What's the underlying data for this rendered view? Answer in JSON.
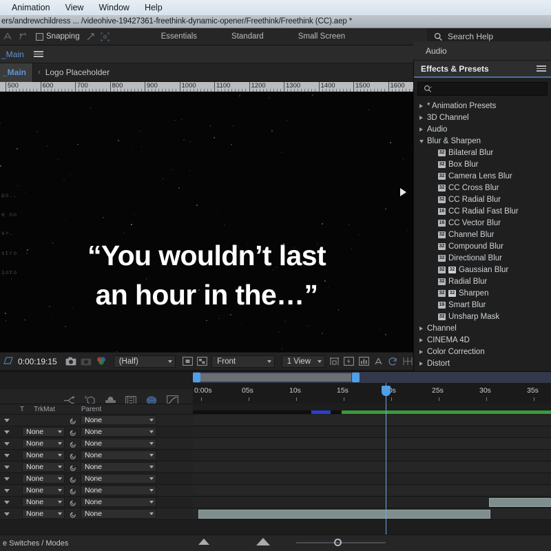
{
  "menu": {
    "items": [
      "Animation",
      "View",
      "Window",
      "Help"
    ]
  },
  "title_bar": {
    "path": "ers/andrewchildress ...  /videohive-19427361-freethink-dynamic-opener/Freethink/Freethink (CC).aep *"
  },
  "toolbar": {
    "snapping_label": "Snapping",
    "workspaces": [
      "Essentials",
      "Standard",
      "Small Screen"
    ],
    "overflow_label": "»",
    "search_placeholder": "Search Help"
  },
  "left_panel": {
    "project_tab": "_Main",
    "comp_tab_active": "_Main",
    "comp_tab_separator": "‹",
    "comp_tab_second": "Logo Placeholder"
  },
  "ruler": {
    "labels": [
      "500",
      "600",
      "700",
      "800",
      "900",
      "1000",
      "1100",
      "1200",
      "1300",
      "1400",
      "1500",
      "1600"
    ]
  },
  "viewer": {
    "quote_line1": "“You wouldn’t last",
    "quote_line2": "an hour in the…”",
    "edge_fragments": [
      "po..",
      "e no",
      "s>.",
      "stro",
      "into"
    ]
  },
  "viewer_bar": {
    "timecode": "0:00:19:15",
    "resolution": "(Half)",
    "view_orientation": "Front",
    "view_layout": "1 View"
  },
  "right_panel": {
    "audio_tab": "Audio",
    "effects_title": "Effects & Presets",
    "search_placeholder": "",
    "categories": [
      {
        "label": "* Animation Presets",
        "open": false,
        "children": []
      },
      {
        "label": "3D Channel",
        "open": false,
        "children": []
      },
      {
        "label": "Audio",
        "open": false,
        "children": []
      },
      {
        "label": "Blur & Sharpen",
        "open": true,
        "children": [
          {
            "name": "Bilateral Blur",
            "badges": [
              "32"
            ]
          },
          {
            "name": "Box Blur",
            "badges": [
              "32"
            ]
          },
          {
            "name": "Camera Lens Blur",
            "badges": [
              "32"
            ]
          },
          {
            "name": "CC Cross Blur",
            "badges": [
              "32"
            ]
          },
          {
            "name": "CC Radial Blur",
            "badges": [
              "32"
            ]
          },
          {
            "name": "CC Radial Fast Blur",
            "badges": [
              "16"
            ]
          },
          {
            "name": "CC Vector Blur",
            "badges": [
              "16"
            ]
          },
          {
            "name": "Channel Blur",
            "badges": [
              "32"
            ]
          },
          {
            "name": "Compound Blur",
            "badges": [
              "32"
            ]
          },
          {
            "name": "Directional Blur",
            "badges": [
              "32"
            ]
          },
          {
            "name": "Gaussian Blur",
            "badges": [
              "32",
              "GPU"
            ]
          },
          {
            "name": "Radial Blur",
            "badges": [
              "32"
            ]
          },
          {
            "name": "Sharpen",
            "badges": [
              "32",
              "GPU"
            ]
          },
          {
            "name": "Smart Blur",
            "badges": [
              "16"
            ]
          },
          {
            "name": "Unsharp Mask",
            "badges": [
              "32"
            ]
          }
        ]
      },
      {
        "label": "Channel",
        "open": false,
        "children": []
      },
      {
        "label": "CINEMA 4D",
        "open": false,
        "children": []
      },
      {
        "label": "Color Correction",
        "open": false,
        "children": []
      },
      {
        "label": "Distort",
        "open": false,
        "children": []
      }
    ]
  },
  "timeline": {
    "column_headers": [
      "T",
      "TrkMat",
      "Parent"
    ],
    "time_labels": [
      "0:00s",
      "05s",
      "10s",
      "15s",
      "20s",
      "25s",
      "30s",
      "35s"
    ],
    "rows": [
      {
        "trkmat": "",
        "parent": "None"
      },
      {
        "trkmat": "None",
        "parent": "None"
      },
      {
        "trkmat": "None",
        "parent": "None"
      },
      {
        "trkmat": "None",
        "parent": "None"
      },
      {
        "trkmat": "None",
        "parent": "None"
      },
      {
        "trkmat": "None",
        "parent": "None"
      },
      {
        "trkmat": "None",
        "parent": "None"
      },
      {
        "trkmat": "None",
        "parent": "None"
      },
      {
        "trkmat": "None",
        "parent": "None"
      }
    ],
    "status_label": "e Switches / Modes"
  },
  "colors": {
    "accent_blue": "#4ea0e8",
    "link_blue": "#5d96d6",
    "panel_bg": "#1f1f1f",
    "green_bar": "#3b9a3b",
    "layer_bar": "#7d8e8c"
  }
}
